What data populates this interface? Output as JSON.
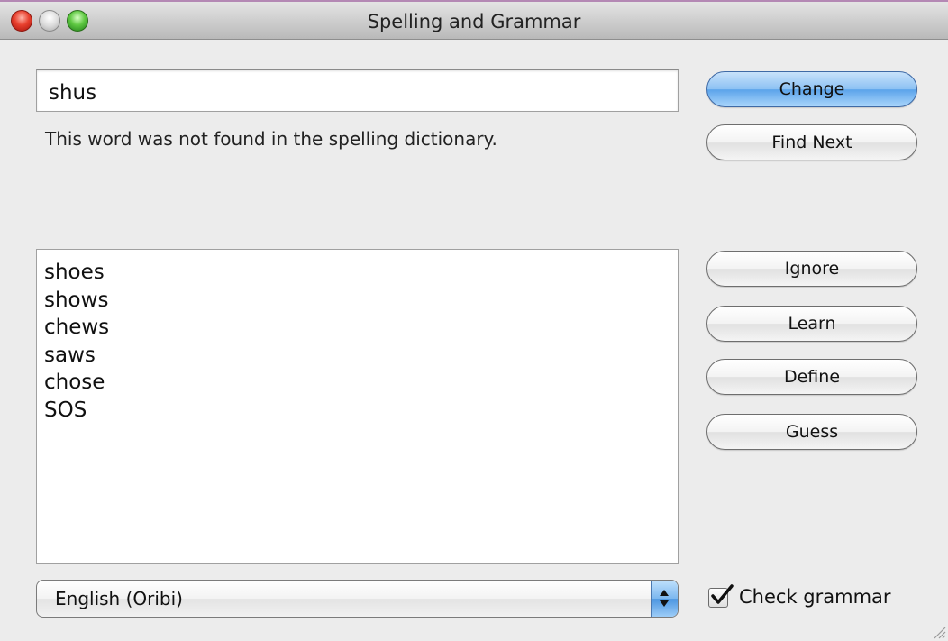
{
  "window": {
    "title": "Spelling and Grammar"
  },
  "misspelled": {
    "word": "shus",
    "status": "This word was not found in the spelling dictionary."
  },
  "suggestions": [
    "shoes",
    "shows",
    "chews",
    "saws",
    "chose",
    "SOS"
  ],
  "buttons": {
    "change": "Change",
    "find_next": "Find Next",
    "ignore": "Ignore",
    "learn": "Learn",
    "define": "Define",
    "guess": "Guess"
  },
  "language": {
    "selected": "English (Oribi)"
  },
  "grammar": {
    "label": "Check grammar",
    "checked": true
  },
  "colors": {
    "default_button": "#5aa3ea",
    "window_bg": "#ececec"
  }
}
